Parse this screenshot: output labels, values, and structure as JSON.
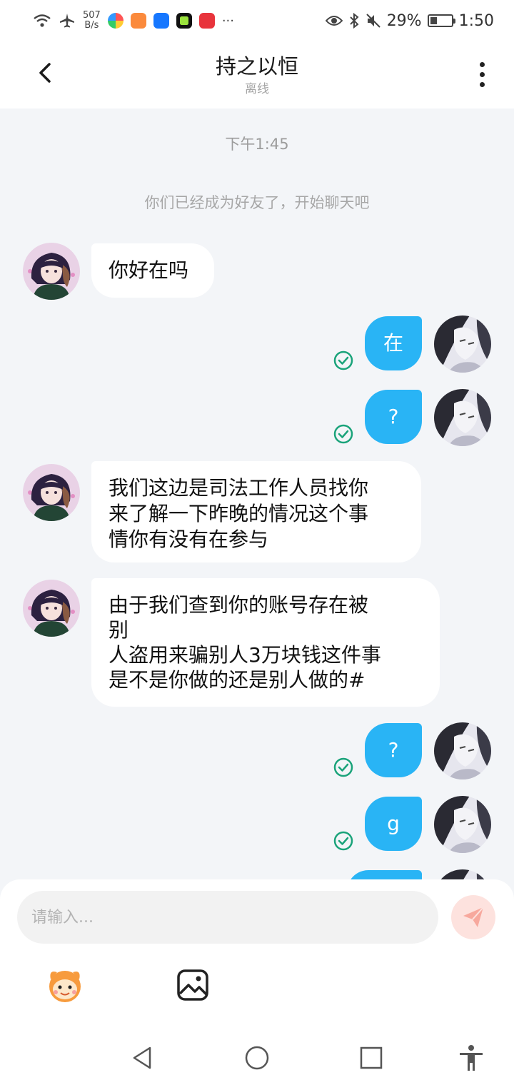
{
  "status_bar": {
    "net_speed_value": "507",
    "net_speed_unit": "B/s",
    "battery": "29%",
    "time": "1:50",
    "more": "···"
  },
  "header": {
    "title": "持之以恒",
    "status": "离线"
  },
  "chat": {
    "timestamp": "下午1:45",
    "system_note": "你们已经成为好友了，开始聊天吧",
    "messages": [
      {
        "side": "in",
        "text": "你好在吗"
      },
      {
        "side": "out",
        "text": "在"
      },
      {
        "side": "out",
        "text": "?"
      },
      {
        "side": "in",
        "text": "我们这边是司法工作人员找你\n来了解一下昨晚的情况这个事\n情你有没有在参与"
      },
      {
        "side": "in",
        "text": "由于我们查到你的账号存在被\n别\n人盗用来骗别人3万块钱这件事\n是不是你做的还是别人做的#"
      },
      {
        "side": "out",
        "text": "?"
      },
      {
        "side": "out",
        "text": "g"
      }
    ]
  },
  "input": {
    "placeholder": "请输入..."
  },
  "colors": {
    "outgoing_bubble": "#29b4f5",
    "incoming_bubble": "#ffffff",
    "check_green": "#1aa37a",
    "send_button_bg": "#fde2de",
    "send_icon": "#f7a89d"
  },
  "icons": {
    "back": "chevron-left-icon",
    "more": "more-vertical-icon",
    "read_receipt": "check-circle-icon",
    "send": "paper-plane-icon",
    "emoji": "sticker-icon",
    "image": "image-icon",
    "nav_back": "triangle-back-icon",
    "nav_home": "circle-home-icon",
    "nav_recent": "square-recent-icon",
    "accessibility": "accessibility-icon"
  }
}
